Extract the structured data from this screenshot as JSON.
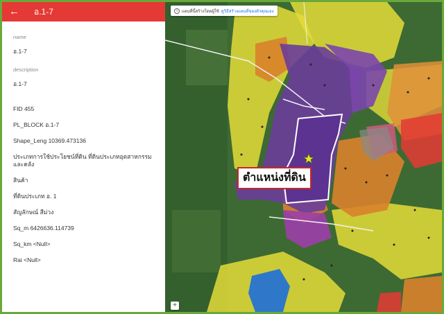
{
  "panel": {
    "title": "อ.1-7",
    "name_label": "name",
    "name_value": "อ.1-7",
    "description_label": "description",
    "description_value": "อ.1-7",
    "details": [
      "FID 455",
      "PL_BLOCK อ.1-7",
      "Shape_Leng 10369.473136",
      "ประเภทการใช้ประโยชน์ที่ดิน ที่ดินประเภทอุตสาหกรรมและคลัง",
      "สินค้า",
      "ที่ดินประเภท อ. 1",
      "สัญลักษณ์ สีม่วง",
      "Sq_m 6426636.114739",
      "Sq_km <Null>",
      "Rai <Null>"
    ],
    "back_icon": "arrow-left-icon"
  },
  "map": {
    "notice_text": "แผนที่นี้สร้างโดยผู้ใช้",
    "notice_link": "ดูวิธีสร้างแผนที่ของตัวคุณเอง",
    "callout_text": "ตำแหน่งที่ดิน",
    "zoom_label": "+",
    "star_icon": "star-icon",
    "colors": {
      "purple": "#6a3d9a",
      "yellow": "#e8e337",
      "orange": "#d9822b",
      "red": "#e53935",
      "blue": "#1e6fd9",
      "star": "#f7e017"
    }
  }
}
